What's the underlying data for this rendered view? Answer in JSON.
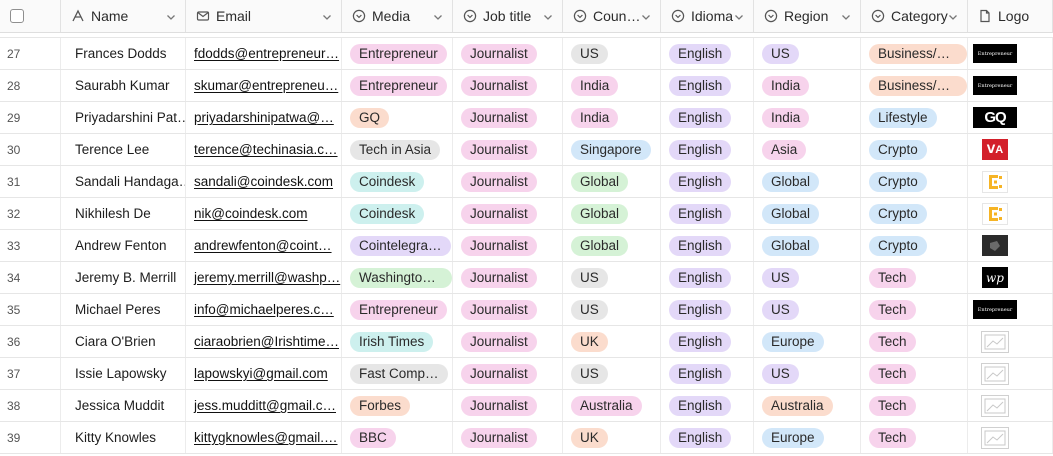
{
  "colors": {
    "header_bg": "#fafafa",
    "border": "#e2e2e2",
    "chip_pink": "#f7d3ec",
    "chip_gray": "#e6e6e6",
    "chip_orange": "#fbdccd",
    "chip_teal": "#cdf0ee",
    "chip_purple": "#e3d8f8",
    "chip_green": "#d5f2d6",
    "chip_blue": "#d2e7f9"
  },
  "header": {
    "columns": [
      {
        "key": "name",
        "label": "Name",
        "icon": "text-type-icon"
      },
      {
        "key": "email",
        "label": "Email",
        "icon": "mail-icon"
      },
      {
        "key": "media",
        "label": "Media",
        "icon": "select-circle-icon"
      },
      {
        "key": "job",
        "label": "Job title",
        "icon": "select-circle-icon"
      },
      {
        "key": "country",
        "label": "Coun…",
        "icon": "select-circle-icon"
      },
      {
        "key": "idioma",
        "label": "Idioma",
        "icon": "select-circle-icon"
      },
      {
        "key": "region",
        "label": "Region",
        "icon": "select-circle-icon"
      },
      {
        "key": "category",
        "label": "Category",
        "icon": "select-circle-icon"
      },
      {
        "key": "logo",
        "label": "Logo",
        "icon": "file-icon"
      }
    ]
  },
  "rows": [
    {
      "num": "27",
      "name": "Frances Dodds",
      "email": "fdodds@entrepreneur…",
      "media": {
        "text": "Entrepreneur",
        "color": "pink"
      },
      "job": "Journalist",
      "country": {
        "text": "US",
        "color": "gray"
      },
      "idioma": "English",
      "region": {
        "text": "US",
        "color": "purple"
      },
      "category": {
        "text": "Business/E…",
        "color": "orange"
      },
      "logo": "entrepreneur"
    },
    {
      "num": "28",
      "name": "Saurabh Kumar",
      "email": "skumar@entrepreneu…",
      "media": {
        "text": "Entrepreneur",
        "color": "pink"
      },
      "job": "Journalist",
      "country": {
        "text": "India",
        "color": "pink"
      },
      "idioma": "English",
      "region": {
        "text": "India",
        "color": "pink"
      },
      "category": {
        "text": "Business/E…",
        "color": "orange"
      },
      "logo": "entrepreneur"
    },
    {
      "num": "29",
      "name": "Priyadarshini Pat…",
      "email": "priyadarshinipatwa@…",
      "media": {
        "text": "GQ",
        "color": "orange"
      },
      "job": "Journalist",
      "country": {
        "text": "India",
        "color": "pink"
      },
      "idioma": "English",
      "region": {
        "text": "India",
        "color": "pink"
      },
      "category": {
        "text": "Lifestyle",
        "color": "blue"
      },
      "logo": "gq"
    },
    {
      "num": "30",
      "name": "Terence Lee",
      "email": "terence@techinasia.c…",
      "media": {
        "text": "Tech in Asia",
        "color": "gray"
      },
      "job": "Journalist",
      "country": {
        "text": "Singapore",
        "color": "blue"
      },
      "idioma": "English",
      "region": {
        "text": "Asia",
        "color": "pink"
      },
      "category": {
        "text": "Crypto",
        "color": "blue"
      },
      "logo": "techinasia"
    },
    {
      "num": "31",
      "name": "Sandali Handaga…",
      "email": "sandali@coindesk.com",
      "media": {
        "text": "Coindesk",
        "color": "teal"
      },
      "job": "Journalist",
      "country": {
        "text": "Global",
        "color": "green"
      },
      "idioma": "English",
      "region": {
        "text": "Global",
        "color": "blue"
      },
      "category": {
        "text": "Crypto",
        "color": "blue"
      },
      "logo": "coindesk"
    },
    {
      "num": "32",
      "name": "Nikhilesh De",
      "email": "nik@coindesk.com",
      "media": {
        "text": "Coindesk",
        "color": "teal"
      },
      "job": "Journalist",
      "country": {
        "text": "Global",
        "color": "green"
      },
      "idioma": "English",
      "region": {
        "text": "Global",
        "color": "blue"
      },
      "category": {
        "text": "Crypto",
        "color": "blue"
      },
      "logo": "coindesk"
    },
    {
      "num": "33",
      "name": "Andrew Fenton",
      "email": "andrewfenton@coint…",
      "media": {
        "text": "Cointelegra…",
        "color": "purple"
      },
      "job": "Journalist",
      "country": {
        "text": "Global",
        "color": "green"
      },
      "idioma": "English",
      "region": {
        "text": "Global",
        "color": "blue"
      },
      "category": {
        "text": "Crypto",
        "color": "blue"
      },
      "logo": "cointelegraph"
    },
    {
      "num": "34",
      "name": "Jeremy B. Merrill",
      "email": "jeremy.merrill@washp…",
      "media": {
        "text": "Washington…",
        "color": "green"
      },
      "job": "Journalist",
      "country": {
        "text": "US",
        "color": "gray"
      },
      "idioma": "English",
      "region": {
        "text": "US",
        "color": "purple"
      },
      "category": {
        "text": "Tech",
        "color": "pink"
      },
      "logo": "washpost"
    },
    {
      "num": "35",
      "name": "Michael Peres",
      "email": "info@michaelperes.c…",
      "media": {
        "text": "Entrepreneur",
        "color": "pink"
      },
      "job": "Journalist",
      "country": {
        "text": "US",
        "color": "gray"
      },
      "idioma": "English",
      "region": {
        "text": "US",
        "color": "purple"
      },
      "category": {
        "text": "Tech",
        "color": "pink"
      },
      "logo": "entrepreneur"
    },
    {
      "num": "36",
      "name": "Ciara O'Brien",
      "email": "ciaraobrien@Irishtime…",
      "media": {
        "text": "Irish Times",
        "color": "teal"
      },
      "job": "Journalist",
      "country": {
        "text": "UK",
        "color": "orange"
      },
      "idioma": "English",
      "region": {
        "text": "Europe",
        "color": "blue"
      },
      "category": {
        "text": "Tech",
        "color": "pink"
      },
      "logo": "placeholder"
    },
    {
      "num": "37",
      "name": "Issie Lapowsky",
      "email": "lapowskyi@gmail.com",
      "media": {
        "text": "Fast Comp…",
        "color": "gray"
      },
      "job": "Journalist",
      "country": {
        "text": "US",
        "color": "gray"
      },
      "idioma": "English",
      "region": {
        "text": "US",
        "color": "purple"
      },
      "category": {
        "text": "Tech",
        "color": "pink"
      },
      "logo": "placeholder"
    },
    {
      "num": "38",
      "name": "Jessica Muddit",
      "email": "jess.mudditt@gmail.c…",
      "media": {
        "text": "Forbes",
        "color": "orange"
      },
      "job": "Journalist",
      "country": {
        "text": "Australia",
        "color": "pink"
      },
      "idioma": "English",
      "region": {
        "text": "Australia",
        "color": "orange"
      },
      "category": {
        "text": "Tech",
        "color": "pink"
      },
      "logo": "placeholder"
    },
    {
      "num": "39",
      "name": "Kitty Knowles",
      "email": "kittygknowles@gmail.…",
      "media": {
        "text": "BBC",
        "color": "pink"
      },
      "job": "Journalist",
      "country": {
        "text": "UK",
        "color": "orange"
      },
      "idioma": "English",
      "region": {
        "text": "Europe",
        "color": "blue"
      },
      "category": {
        "text": "Tech",
        "color": "pink"
      },
      "logo": "placeholder"
    }
  ]
}
